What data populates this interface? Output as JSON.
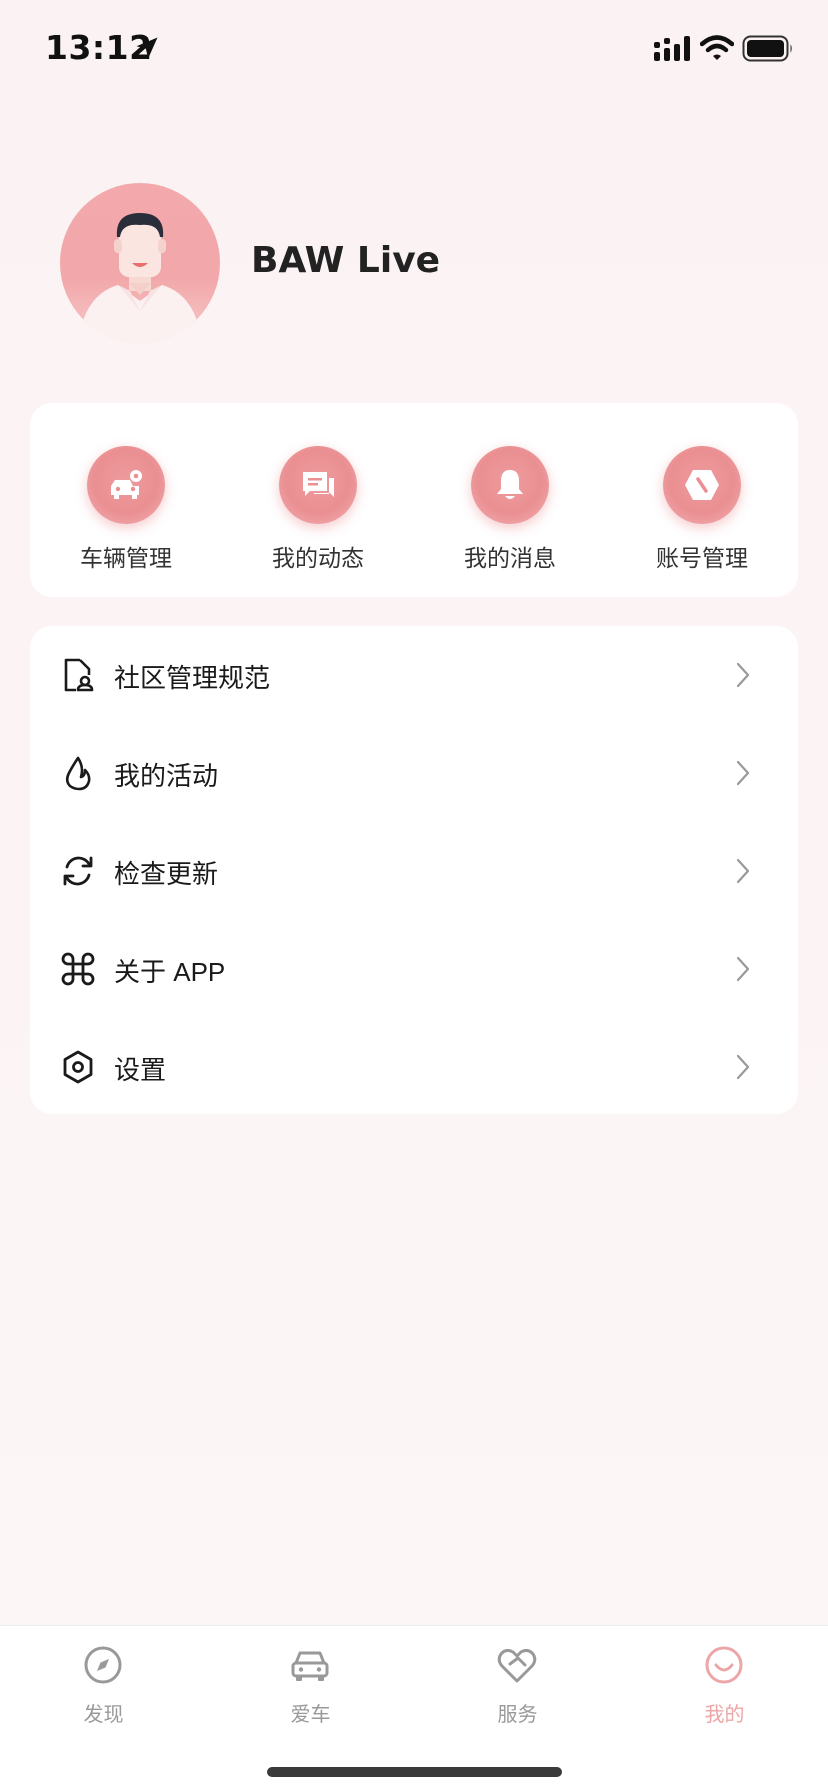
{
  "status_bar": {
    "time": "13:12",
    "icons": [
      "location-arrow-icon",
      "signal-icon",
      "wifi-icon",
      "battery-icon"
    ]
  },
  "profile": {
    "username": "BAW Live",
    "avatar": "avatar-illustration"
  },
  "quick_actions": [
    {
      "label": "车辆管理",
      "icon": "vehicle-manage-icon"
    },
    {
      "label": "我的动态",
      "icon": "chat-feed-icon"
    },
    {
      "label": "我的消息",
      "icon": "bell-icon"
    },
    {
      "label": "账号管理",
      "icon": "account-hexagon-icon"
    }
  ],
  "menu": [
    {
      "label": "社区管理规范",
      "icon": "document-person-icon"
    },
    {
      "label": "我的活动",
      "icon": "flame-icon"
    },
    {
      "label": "检查更新",
      "icon": "refresh-icon"
    },
    {
      "label": "关于 APP",
      "icon": "command-icon"
    },
    {
      "label": "设置",
      "icon": "hexagon-settings-icon"
    }
  ],
  "tabs": [
    {
      "label": "发现",
      "icon": "compass-icon",
      "active": false
    },
    {
      "label": "爱车",
      "icon": "car-icon",
      "active": false
    },
    {
      "label": "服务",
      "icon": "heart-handshake-icon",
      "active": false
    },
    {
      "label": "我的",
      "icon": "smile-icon",
      "active": true
    }
  ],
  "colors": {
    "accent": "#ea8f92",
    "active_tab": "#eda6a8",
    "background": "#fbf4f4",
    "card": "#ffffff"
  }
}
